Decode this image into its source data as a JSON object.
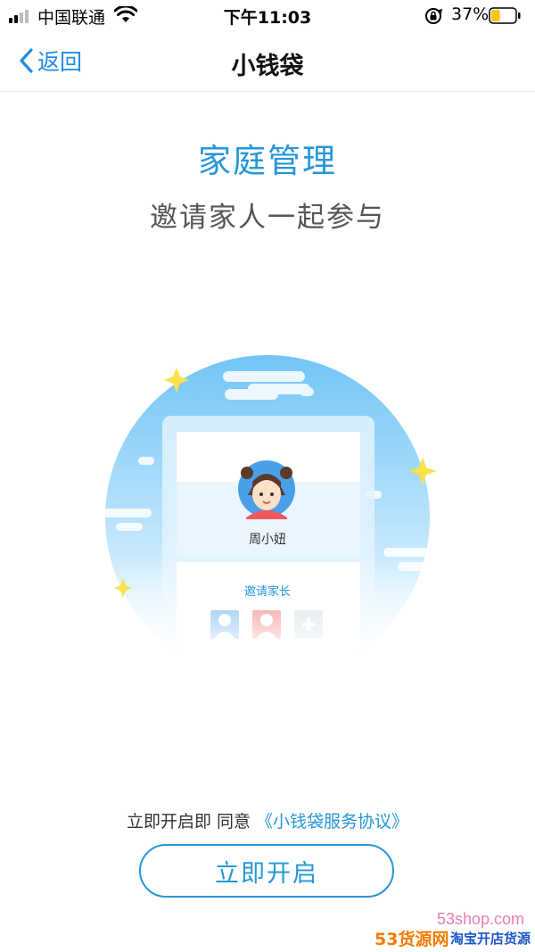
{
  "status_bar": {
    "carrier": "中国联通",
    "time": "下午11:03",
    "battery_percent": "37%",
    "battery_level": 0.37,
    "battery_color": "#f5c518",
    "signal_bars_active": 2,
    "icons": [
      "signal-icon",
      "wifi-icon",
      "orientation-lock-icon",
      "battery-icon"
    ]
  },
  "nav": {
    "back_label": "返回",
    "title": "小钱袋"
  },
  "hero": {
    "title": "家庭管理",
    "subtitle": "邀请家人一起参与"
  },
  "illustration": {
    "child_name": "周小妞",
    "invite_label": "邀请家长"
  },
  "agreement": {
    "prefix": "立即开启即 同意",
    "link_text": "《小钱袋服务协议》"
  },
  "start_button": {
    "label": "立即开启"
  },
  "watermark": {
    "url": "53shop.com",
    "main": "53货源网",
    "sub": "淘宝开店货源"
  },
  "colors": {
    "accent": "#2596d8",
    "sky_top": "#6fc3f5",
    "sky_bottom": "#f3fbff",
    "star": "#fbe14a"
  }
}
